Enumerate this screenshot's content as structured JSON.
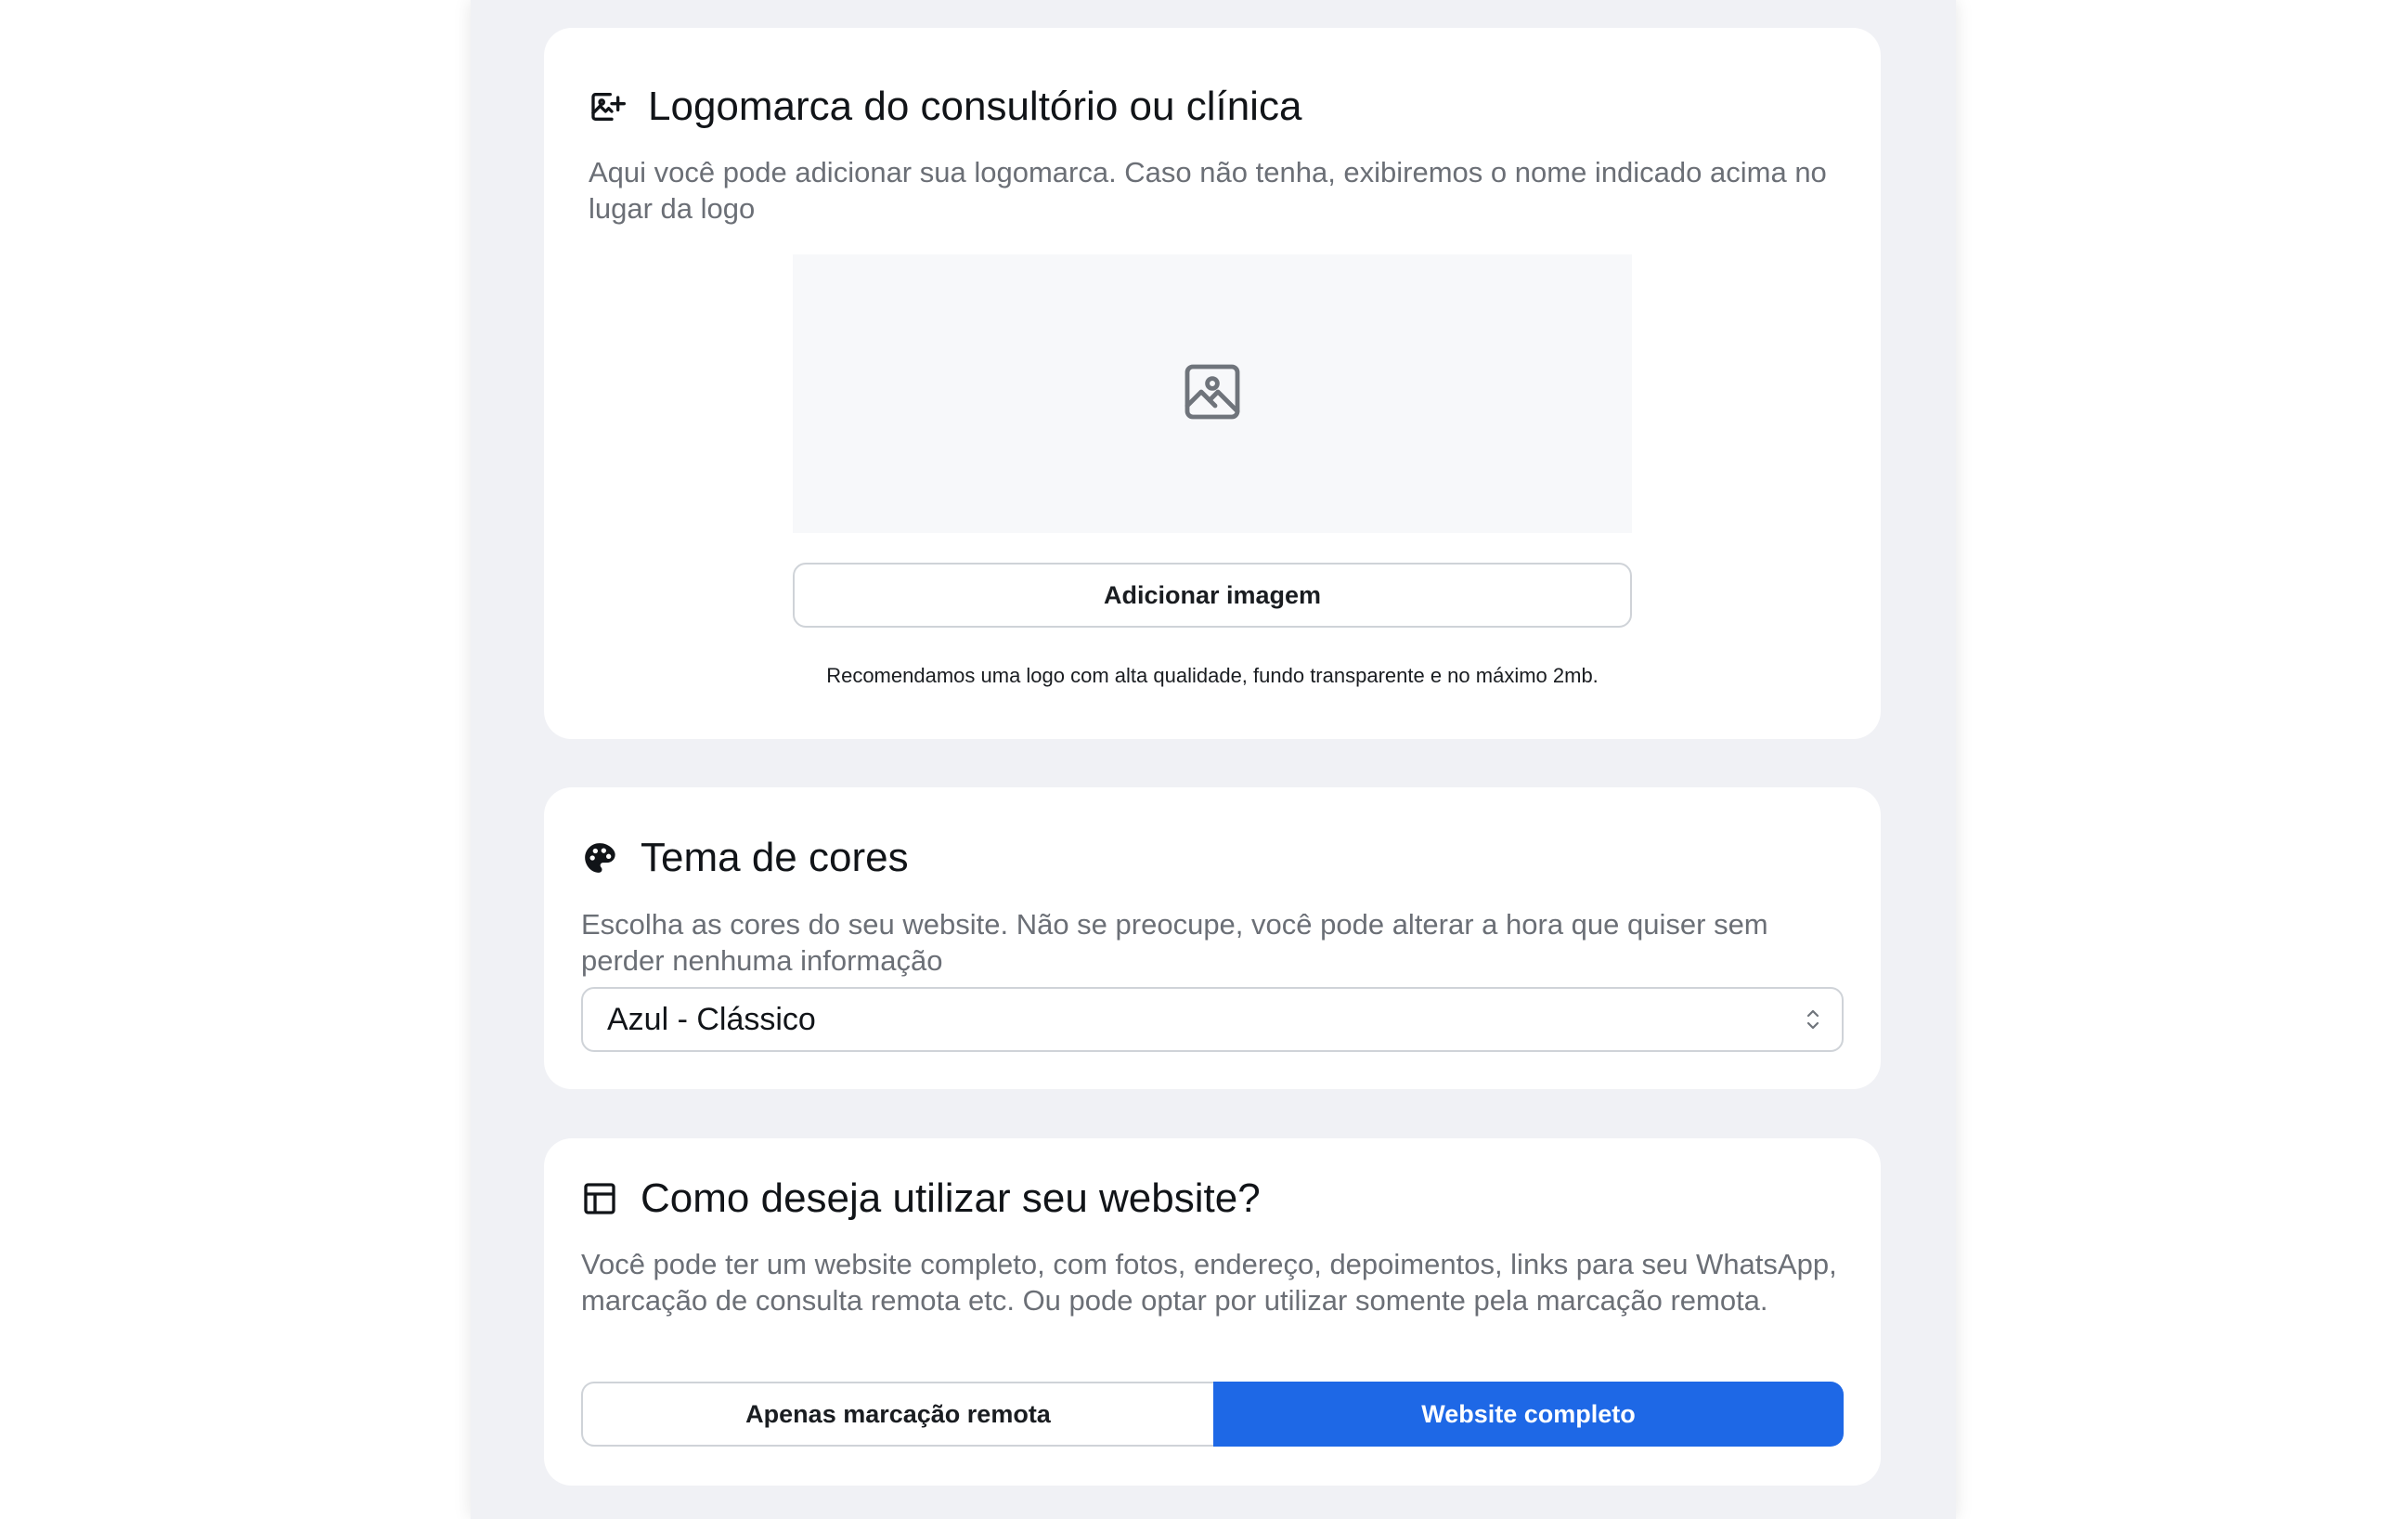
{
  "logo_section": {
    "title": "Logomarca do consultório ou clínica",
    "description": "Aqui você pode adicionar sua logomarca. Caso não tenha, exibiremos o nome indicado acima no lugar da logo",
    "title_icon": "image-add-icon",
    "placeholder_icon": "image-placeholder-icon",
    "add_button_label": "Adicionar imagem",
    "hint": "Recomendamos uma logo com alta qualidade, fundo transparente e no máximo 2mb."
  },
  "theme_section": {
    "title": "Tema de cores",
    "description": "Escolha as cores do seu website. Não se preocupe, você pode alterar a hora que quiser sem perder nenhuma informação",
    "title_icon": "palette-icon",
    "selected_theme": "Azul - Clássico"
  },
  "usage_section": {
    "title": "Como deseja utilizar seu website?",
    "description": "Você pode ter um website completo, com fotos, endereço, depoimentos, links para seu WhatsApp, marcação de consulta remota etc. Ou pode optar por utilizar somente pela marcação remota.",
    "title_icon": "layout-icon",
    "option_remote": "Apenas marcação remota",
    "option_full": "Website completo",
    "selected_option": "Website completo"
  },
  "colors": {
    "accent": "#1e68e6",
    "page_background": "#f0f1f5",
    "card_background": "#ffffff"
  }
}
